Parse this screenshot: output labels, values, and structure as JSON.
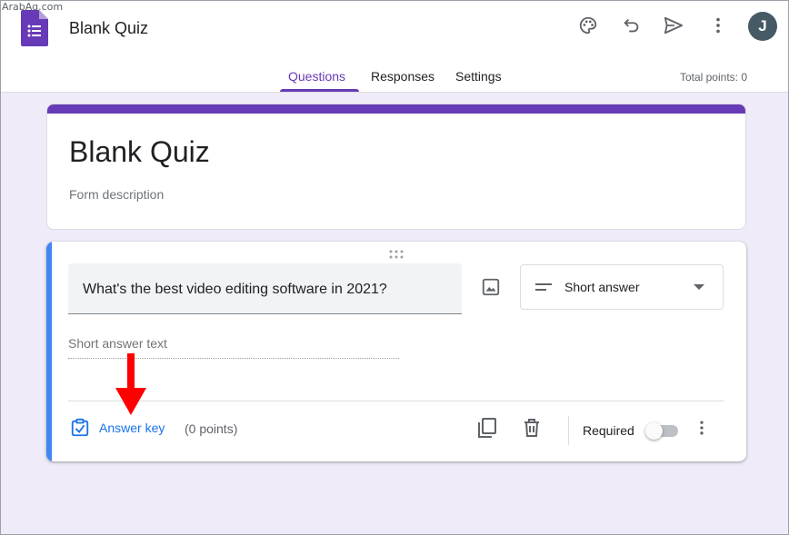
{
  "watermark": "ArabAq.com",
  "header": {
    "doc_title": "Blank Quiz",
    "avatar_initial": "J",
    "icons": [
      "palette-icon",
      "undo-icon",
      "send-icon",
      "more-vert-icon"
    ]
  },
  "tabs": [
    {
      "label": "Questions",
      "active": true
    },
    {
      "label": "Responses",
      "active": false
    },
    {
      "label": "Settings",
      "active": false
    }
  ],
  "total_points": "Total points: 0",
  "title_card": {
    "title": "Blank Quiz",
    "description_placeholder": "Form description"
  },
  "question": {
    "text": "What's the best video editing software in 2021?",
    "type_label": "Short answer",
    "answer_placeholder": "Short answer text",
    "answer_key_label": "Answer key",
    "points": "(0 points)",
    "required_label": "Required",
    "required": false
  },
  "colors": {
    "accent_purple": "#673ab7",
    "question_accent_blue": "#4285f4",
    "link_blue": "#1a73e8",
    "background": "#f0ebf8",
    "annotation_red": "#ff0000"
  }
}
